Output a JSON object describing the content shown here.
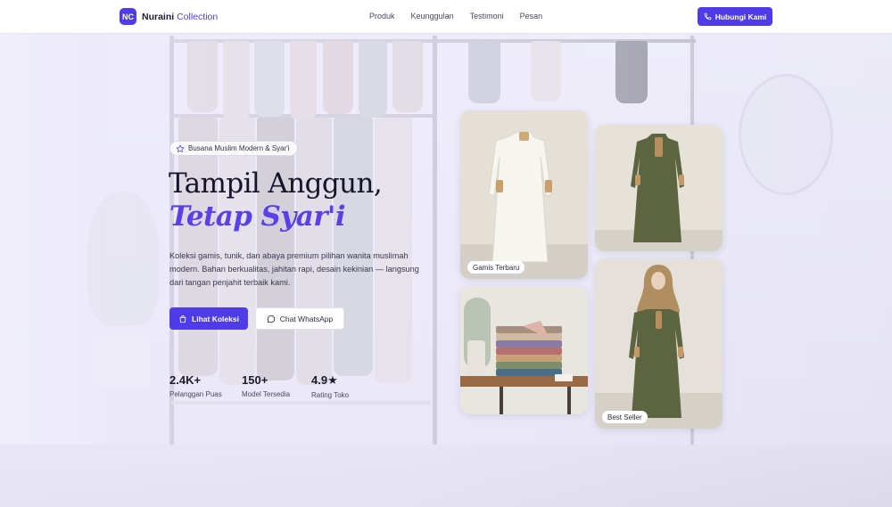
{
  "brand": {
    "logo_mark": "NC",
    "name_bold": "Nuraini",
    "name_accent": "Collection"
  },
  "nav": {
    "links": [
      "Produk",
      "Keunggulan",
      "Testimoni",
      "Pesan"
    ],
    "cta_label": "Hubungi Kami",
    "cta_icon": "phone-icon"
  },
  "hero": {
    "badge": "Busana Muslim Modern & Syar'i",
    "badge_icon": "star-outline-icon",
    "title_line1": "Tampil Anggun,",
    "title_line2": "Tetap Syar'i",
    "description": "Koleksi gamis, tunik, dan abaya premium pilihan wanita muslimah modern. Bahan berkualitas, jahitan rapi, desain kekinian — langsung dari tangan penjahit terbaik kami.",
    "primary_button": "Lihat Koleksi",
    "primary_icon": "bag-icon",
    "secondary_button": "Chat WhatsApp",
    "secondary_icon": "chat-icon"
  },
  "stats": [
    {
      "value": "2.4K+",
      "label": "Pelanggan Puas"
    },
    {
      "value": "150+",
      "label": "Model Tersedia"
    },
    {
      "value": "4.9★",
      "label": "Rating Toko"
    }
  ],
  "cards": [
    {
      "label": "Gamis Terbaru"
    },
    {
      "label": ""
    },
    {
      "label": ""
    },
    {
      "label": "Best Seller"
    }
  ],
  "colors": {
    "accent": "#4f3ce8",
    "accent_text": "#5a40e6",
    "olive": "#5c6440",
    "cream": "#f3efe6"
  }
}
